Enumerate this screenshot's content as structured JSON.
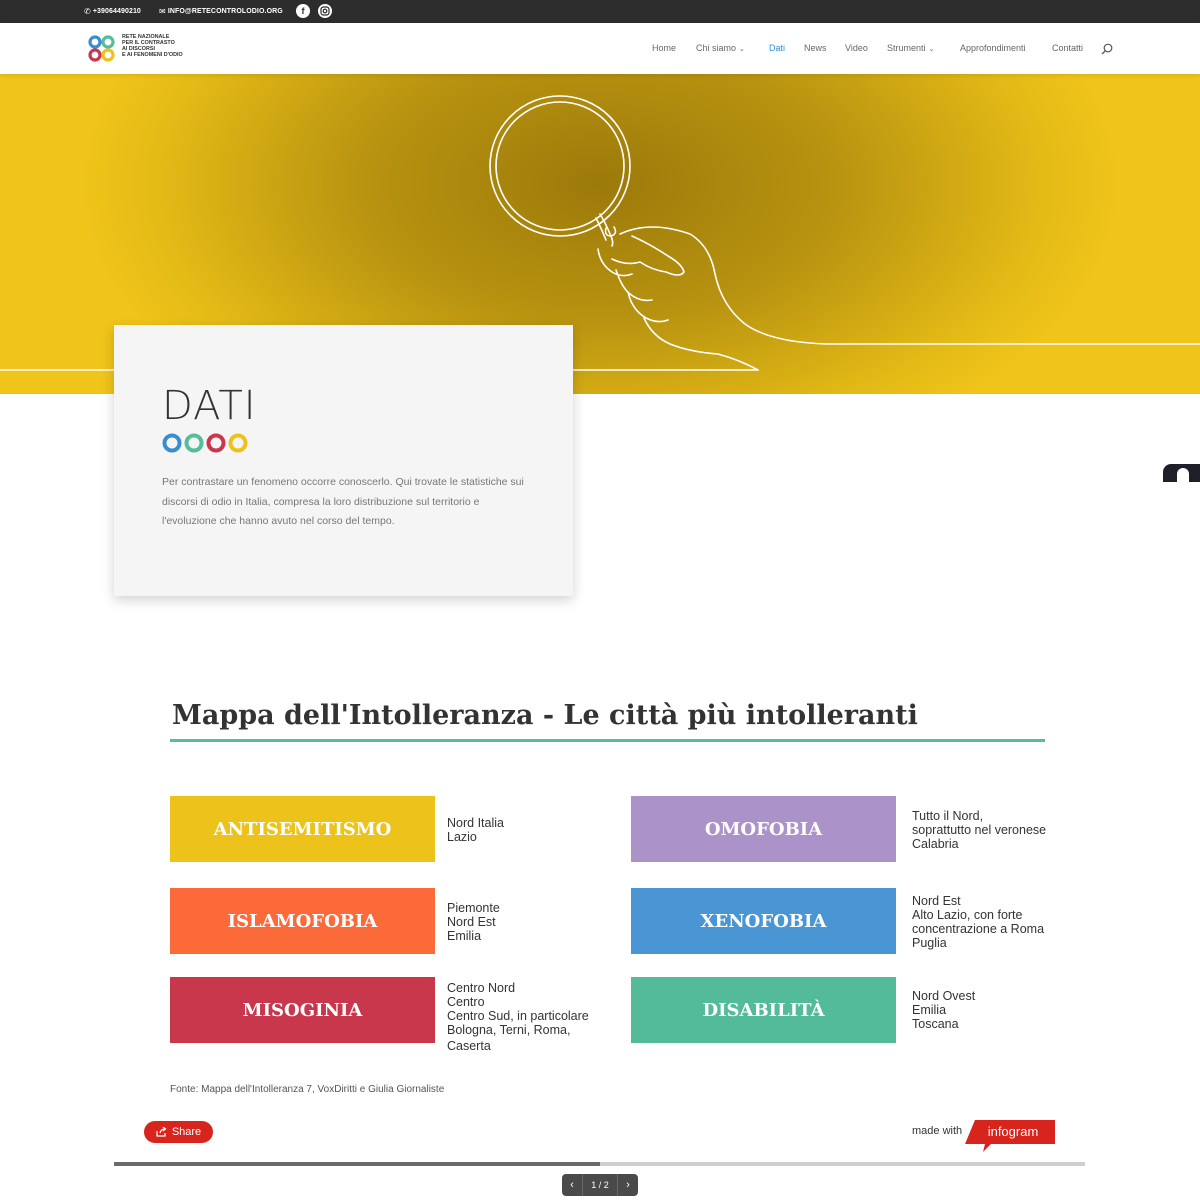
{
  "topbar": {
    "phone": "+39064490210",
    "email": "INFO@RETECONTROLODIO.ORG",
    "social": [
      "facebook-icon",
      "instagram-icon"
    ]
  },
  "logo": {
    "lines": [
      "RETE NAZIONALE",
      "PER IL CONTRASTO",
      "AI DISCORSI",
      "E AI FENOMENI D'ODIO"
    ]
  },
  "nav": {
    "items": [
      {
        "label": "Home"
      },
      {
        "label": "Chi siamo"
      },
      {
        "label": "Dati"
      },
      {
        "label": "News"
      },
      {
        "label": "Video"
      },
      {
        "label": "Strumenti"
      },
      {
        "label": "Approfondimenti"
      },
      {
        "label": "Contatti"
      }
    ],
    "active": "Dati"
  },
  "card": {
    "title": "DATI",
    "text": "Per contrastare un fenomeno occorre conoscerlo. Qui trovate le statistiche sui discorsi di odio in Italia, compresa la loro distribuzione sul territorio e l'evoluzione che hanno avuto nel corso del tempo."
  },
  "infographic": {
    "title": "Mappa dell'Intolleranza - Le città più intolleranti",
    "categories": [
      {
        "name": "ANTISEMITISMO",
        "color": "#edc21a",
        "areas": [
          "Nord Italia",
          "Lazio"
        ]
      },
      {
        "name": "OMOFOBIA",
        "color": "#ab92c8",
        "areas": [
          "Tutto il Nord,",
          "soprattutto nel veronese",
          "Calabria"
        ]
      },
      {
        "name": "ISLAMOFOBIA",
        "color": "#fd6a3a",
        "areas": [
          "Piemonte",
          "Nord Est",
          "Emilia"
        ]
      },
      {
        "name": "XENOFOBIA",
        "color": "#4a95d3",
        "areas": [
          "Nord Est",
          "Alto Lazio, con forte",
          "concentrazione a Roma",
          "Puglia"
        ]
      },
      {
        "name": "MISOGINIA",
        "color": "#c9374c",
        "areas": [
          "Centro Nord",
          "Centro",
          "Centro Sud, in particolare",
          "Bologna, Terni, Roma,",
          "Caserta"
        ]
      },
      {
        "name": "DISABILITÀ",
        "color": "#53ba9a",
        "areas": [
          "Nord Ovest",
          "Emilia",
          "Toscana"
        ]
      }
    ],
    "source": "Fonte: Mappa dell'Intolleranza 7, VoxDiritti e Giulia Giornaliste",
    "share_label": "Share",
    "made_with": "made with",
    "brand": "infogram",
    "page_indicator": "1 / 2",
    "progress": 0.5
  }
}
